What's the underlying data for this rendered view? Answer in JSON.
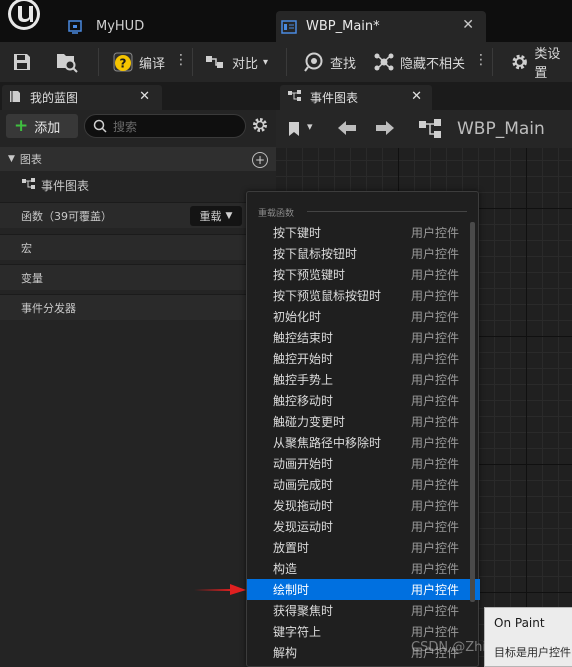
{
  "colors": {
    "accent": "#0070e0",
    "add_plus": "#3fbf3f",
    "arrow": "#e02020"
  },
  "document_tabs": [
    {
      "label": "MyHUD",
      "icon": "widget-blueprint-icon"
    },
    {
      "label": "WBP_Main*",
      "icon": "graph-editor-icon"
    }
  ],
  "toolbar": {
    "compile_label": "编译",
    "diff_label": "对比",
    "find_label": "查找",
    "hide_unrelated_label": "隐藏不相关",
    "class_settings_label": "类设置"
  },
  "my_blueprint": {
    "tab_label": "我的蓝图",
    "add_label": "添加",
    "search_placeholder": "搜索",
    "graphs_label": "图表",
    "event_graph_label": "事件图表",
    "functions_label": "函数（39可覆盖）",
    "override_label": "重载",
    "macros_label": "宏",
    "variables_label": "变量",
    "event_dispatchers_label": "事件分发器"
  },
  "graph": {
    "tab_label": "事件图表",
    "title": "WBP_Main"
  },
  "override_menu": {
    "header": "重载函数",
    "selected_index": 17,
    "items": [
      {
        "name": "按下键时",
        "category": "用户控件"
      },
      {
        "name": "按下鼠标按钮时",
        "category": "用户控件"
      },
      {
        "name": "按下预览键时",
        "category": "用户控件"
      },
      {
        "name": "按下预览鼠标按钮时",
        "category": "用户控件"
      },
      {
        "name": "初始化时",
        "category": "用户控件"
      },
      {
        "name": "触控结束时",
        "category": "用户控件"
      },
      {
        "name": "触控开始时",
        "category": "用户控件"
      },
      {
        "name": "触控手势上",
        "category": "用户控件"
      },
      {
        "name": "触控移动时",
        "category": "用户控件"
      },
      {
        "name": "触碰力变更时",
        "category": "用户控件"
      },
      {
        "name": "从聚焦路径中移除时",
        "category": "用户控件"
      },
      {
        "name": "动画开始时",
        "category": "用户控件"
      },
      {
        "name": "动画完成时",
        "category": "用户控件"
      },
      {
        "name": "发现拖动时",
        "category": "用户控件"
      },
      {
        "name": "发现运动时",
        "category": "用户控件"
      },
      {
        "name": "放置时",
        "category": "用户控件"
      },
      {
        "name": "构造",
        "category": "用户控件"
      },
      {
        "name": "绘制时",
        "category": "用户控件"
      },
      {
        "name": "获得聚焦时",
        "category": "用户控件"
      },
      {
        "name": "键字符上",
        "category": "用户控件"
      },
      {
        "name": "解构",
        "category": "用户控件"
      }
    ]
  },
  "tooltip": {
    "title": "On Paint",
    "target": "目标是用户控件"
  },
  "watermark": "CSDN @Zhi"
}
